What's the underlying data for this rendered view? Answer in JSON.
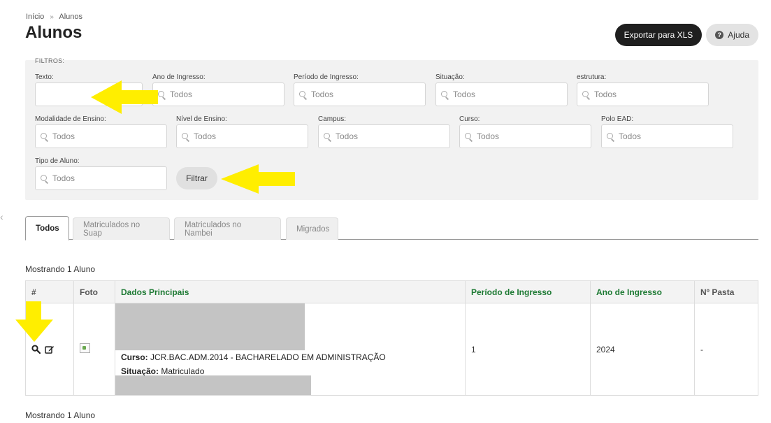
{
  "breadcrumb": {
    "home": "Início",
    "separator": "»",
    "current": "Alunos"
  },
  "page_title": "Alunos",
  "actions": {
    "export_label": "Exportar para XLS",
    "help_label": "Ajuda",
    "help_icon": "question-circle-icon"
  },
  "filters": {
    "title": "FILTROS:",
    "texto_label": "Texto:",
    "texto_value": "",
    "fields": [
      {
        "label": "Ano de Ingresso:",
        "placeholder": "Todos"
      },
      {
        "label": "Período de Ingresso:",
        "placeholder": "Todos"
      },
      {
        "label": "Situação:",
        "placeholder": "Todos"
      },
      {
        "label": "estrutura:",
        "placeholder": "Todos"
      },
      {
        "label": "Modalidade de Ensino:",
        "placeholder": "Todos"
      },
      {
        "label": "Nível de Ensino:",
        "placeholder": "Todos"
      },
      {
        "label": "Campus:",
        "placeholder": "Todos"
      },
      {
        "label": "Curso:",
        "placeholder": "Todos"
      },
      {
        "label": "Polo EAD:",
        "placeholder": "Todos"
      },
      {
        "label": "Tipo de Aluno:",
        "placeholder": "Todos"
      }
    ],
    "filter_button": "Filtrar"
  },
  "tabs": [
    {
      "label": "Todos",
      "active": true
    },
    {
      "label": "Matriculados no Suap",
      "active": false
    },
    {
      "label": "Matriculados no Nambei",
      "active": false
    },
    {
      "label": "Migrados",
      "active": false
    }
  ],
  "showing_top": "Mostrando 1 Aluno",
  "showing_bottom": "Mostrando 1 Aluno",
  "table": {
    "headers": [
      "#",
      "Foto",
      "Dados Principais",
      "Período de Ingresso",
      "Ano de Ingresso",
      "Nº Pasta"
    ],
    "rows": [
      {
        "curso_label": "Curso:",
        "curso_value": "JCR.BAC.ADM.2014 - BACHARELADO EM ADMINISTRAÇÃO",
        "situacao_label": "Situação:",
        "situacao_value": "Matriculado",
        "periodo": "1",
        "ano": "2024",
        "pasta": "-"
      }
    ]
  },
  "colors": {
    "accent_green": "#1e7a34",
    "dark_button": "#1f1f1f",
    "annotation_yellow": "#ffee00"
  }
}
